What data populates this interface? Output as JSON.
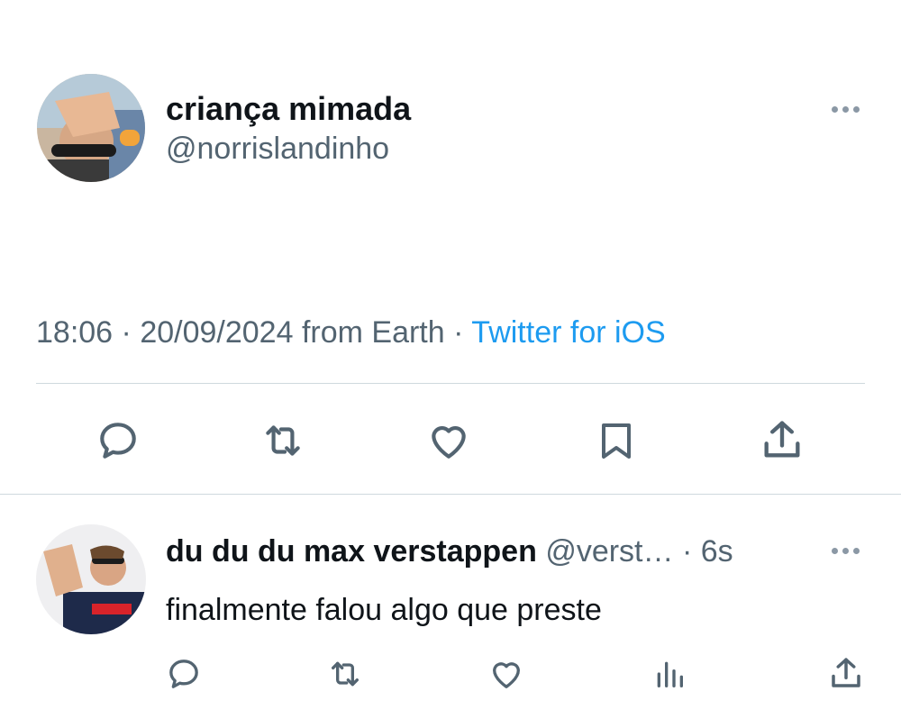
{
  "main_tweet": {
    "display_name": "criança mimada",
    "handle": "@norrislandinho",
    "time": "18:06",
    "date": "20/09/2024",
    "location": "from Earth",
    "separator": "·",
    "client": "Twitter for iOS",
    "actions": [
      "reply-icon",
      "retweet-icon",
      "like-icon",
      "bookmark-icon",
      "share-icon"
    ]
  },
  "reply": {
    "display_name": "du du du max verstappen",
    "handle": "@verst…",
    "separator": "·",
    "time_ago": "6s",
    "text": "finalmente falou algo que preste",
    "actions": [
      "reply-icon",
      "retweet-icon",
      "like-icon",
      "views-icon",
      "share-icon"
    ]
  },
  "colors": {
    "text": "#0f1419",
    "muted": "#536471",
    "link": "#1d9bf0",
    "divider": "#cfd9de"
  }
}
